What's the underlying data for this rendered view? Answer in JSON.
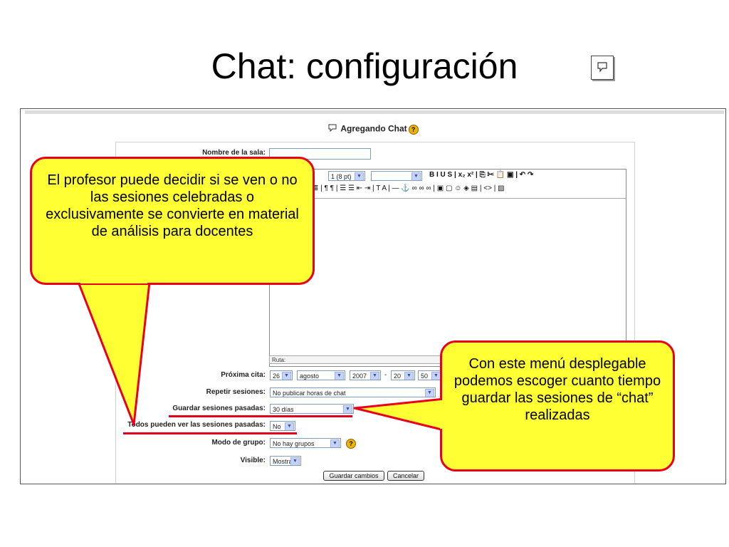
{
  "slide": {
    "title": "Chat: configuración",
    "title_icon": "chat-bubble-icon"
  },
  "form": {
    "heading": "Agregando Chat",
    "room_name_label": "Nombre de la sala:",
    "room_name_value": "",
    "editor": {
      "font_size_value": "1 (8 pt)",
      "toolbar_row1": "B  I  U  S  |  x₂  x²  |  ⎘  ✂  📋  ▣  |  ↶  ↷",
      "toolbar_row2": "≣ | ¶ ¶ | ☰ ☰ ⇤ ⇥ | T A | — ⚓ ∞ ∞ ∞ | ▣ ▢ ☺ ◈ ▤ | <> | ▨",
      "path_label": "Ruta:"
    },
    "next_chat_label": "Próxima cita:",
    "next_chat": {
      "day": "26",
      "month": "agosto",
      "year": "2007",
      "separator": "-",
      "hour": "20",
      "minute": "50"
    },
    "repeat_label": "Repetir sesiones:",
    "repeat_value": "No publicar horas de chat",
    "save_sessions_label": "Guardar sesiones pasadas:",
    "save_sessions_value": "30 días",
    "everyone_view_label": "Todos pueden ver las sesiones pasadas:",
    "everyone_view_value": "No",
    "group_mode_label": "Modo de grupo:",
    "group_mode_value": "No hay grupos",
    "visible_label": "Visible:",
    "visible_value": "Mostrar",
    "save_button": "Guardar cambios",
    "cancel_button": "Cancelar"
  },
  "callouts": {
    "left": "El profesor puede decidir si se ven o no las sesiones celebradas o exclusivamente se convierte en material de análisis para docentes",
    "right": "Con este menú desplegable podemos escoger cuanto tiempo guardar las sesiones de “chat” realizadas"
  },
  "colors": {
    "callout_fill": "#ffff33",
    "callout_border": "#e8001c",
    "underline": "#e0001b"
  }
}
